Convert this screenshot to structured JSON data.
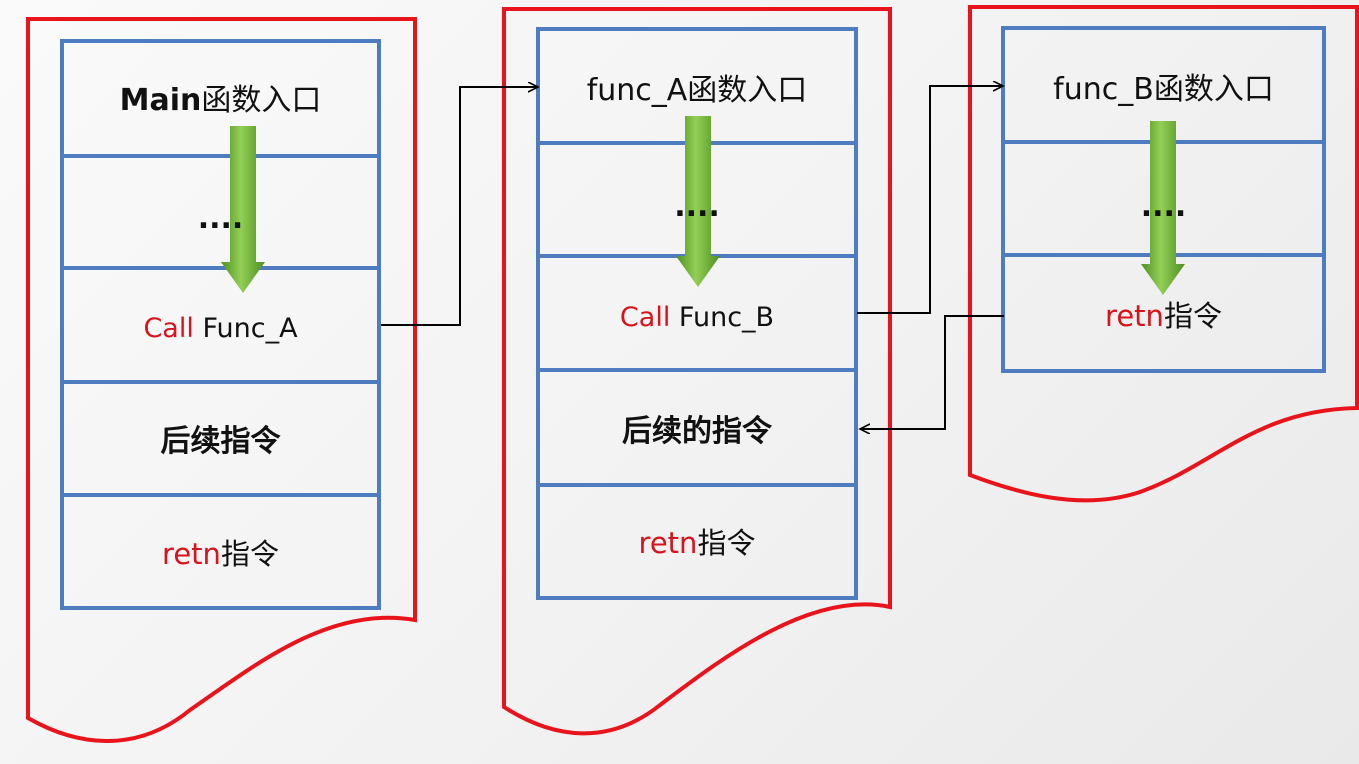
{
  "colors": {
    "frame": "#e8131b",
    "cell_border": "#4f7bc1",
    "text": "#111111",
    "highlight": "#d9121b",
    "flow_arrow_light": "#93cf55",
    "flow_arrow_dark": "#4f8f23",
    "connector": "#000000"
  },
  "panels": [
    {
      "id": "main",
      "cells": [
        {
          "parts": [
            {
              "text": "Main",
              "role": "bold"
            },
            {
              "text": "函数入口",
              "role": "normal"
            }
          ]
        },
        {
          "parts": [
            {
              "text": "....",
              "role": "bold"
            }
          ]
        },
        {
          "parts": [
            {
              "text": "Call",
              "role": "highlight"
            },
            {
              "text": " Func_A",
              "role": "normal"
            }
          ]
        },
        {
          "parts": [
            {
              "text": "后续指令",
              "role": "bold"
            }
          ]
        },
        {
          "parts": [
            {
              "text": "retn",
              "role": "highlight"
            },
            {
              "text": "指令",
              "role": "normal"
            }
          ]
        }
      ]
    },
    {
      "id": "func-a",
      "cells": [
        {
          "parts": [
            {
              "text": "func_A函数入口",
              "role": "normal"
            }
          ]
        },
        {
          "parts": [
            {
              "text": "....",
              "role": "bold"
            }
          ]
        },
        {
          "parts": [
            {
              "text": "Call",
              "role": "highlight"
            },
            {
              "text": " Func_B",
              "role": "normal"
            }
          ]
        },
        {
          "parts": [
            {
              "text": "后续的指令",
              "role": "bold"
            }
          ]
        },
        {
          "parts": [
            {
              "text": "retn",
              "role": "highlight"
            },
            {
              "text": "指令",
              "role": "normal"
            }
          ]
        }
      ]
    },
    {
      "id": "func-b",
      "cells": [
        {
          "parts": [
            {
              "text": "func_B函数入口",
              "role": "normal"
            }
          ]
        },
        {
          "parts": [
            {
              "text": "....",
              "role": "bold"
            }
          ]
        },
        {
          "parts": [
            {
              "text": "retn",
              "role": "highlight"
            },
            {
              "text": "指令",
              "role": "normal"
            }
          ]
        }
      ]
    }
  ],
  "connections": [
    {
      "from": "main: Call Func_A",
      "to": "func-a: func_A函数入口"
    },
    {
      "from": "func-a: Call Func_B",
      "to": "func-b: func_B函数入口"
    },
    {
      "from": "func-b: retn指令",
      "to": "func-a: 后续的指令"
    }
  ]
}
